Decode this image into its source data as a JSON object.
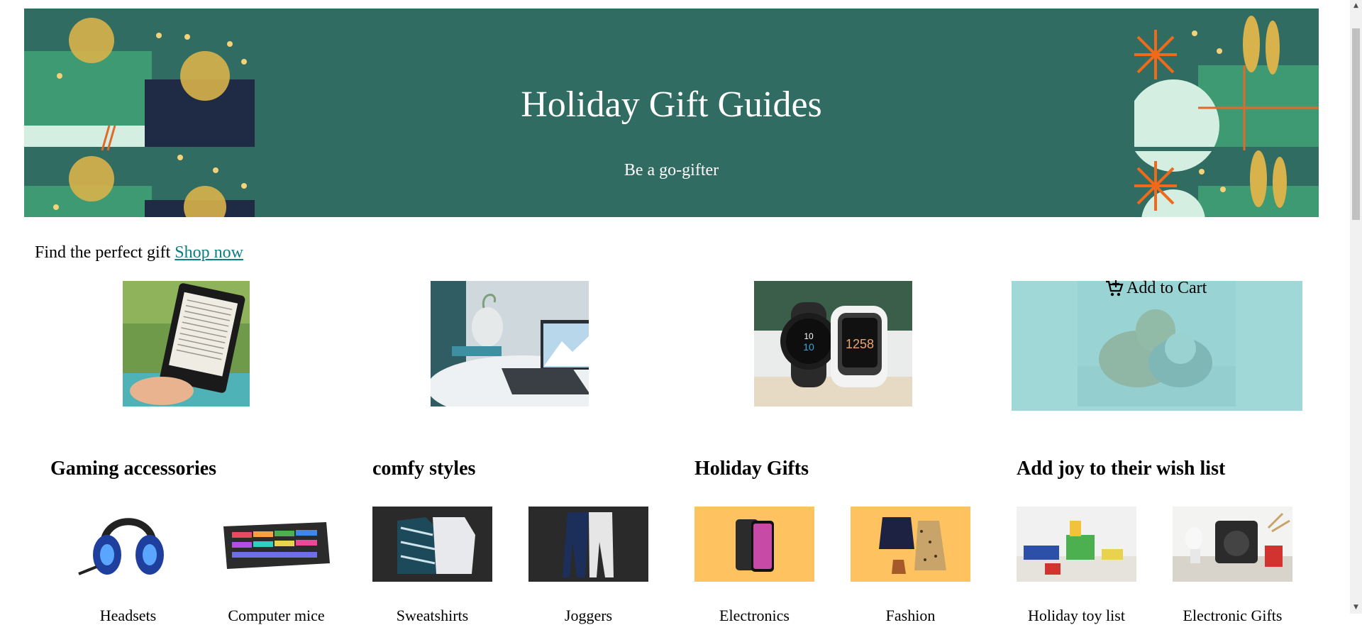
{
  "hero": {
    "title": "Holiday Gift Guides",
    "subtitle": "Be a go-gifter",
    "bg_color": "#316c62"
  },
  "intro": {
    "text": "Find the perfect gift",
    "link": "Shop now",
    "link_color": "#0b7e80"
  },
  "promos": [
    {
      "name": "kindle-ereader-image"
    },
    {
      "name": "laptop-desk-image"
    },
    {
      "name": "smartwatches-image"
    },
    {
      "name": "pets-image"
    }
  ],
  "cart": {
    "label": "Add to Cart",
    "icon": "cart-plus-icon",
    "overlay_color": "#7cc9c9"
  },
  "sections": [
    {
      "title": "Gaming accessories",
      "items": [
        {
          "label": "Headsets",
          "icon": "gaming-headset"
        },
        {
          "label": "Computer mice",
          "icon": "rgb-keyboard"
        }
      ]
    },
    {
      "title": "comfy styles",
      "items": [
        {
          "label": "Sweatshirts",
          "icon": "sweatshirts"
        },
        {
          "label": "Joggers",
          "icon": "joggers"
        }
      ]
    },
    {
      "title": "Holiday Gifts",
      "items": [
        {
          "label": "Electronics",
          "icon": "smartphone"
        },
        {
          "label": "Fashion",
          "icon": "outfit"
        }
      ]
    },
    {
      "title": "Add joy to their wish list",
      "items": [
        {
          "label": "Holiday toy list",
          "icon": "toys"
        },
        {
          "label": "Electronic Gifts",
          "icon": "speaker"
        }
      ]
    }
  ]
}
